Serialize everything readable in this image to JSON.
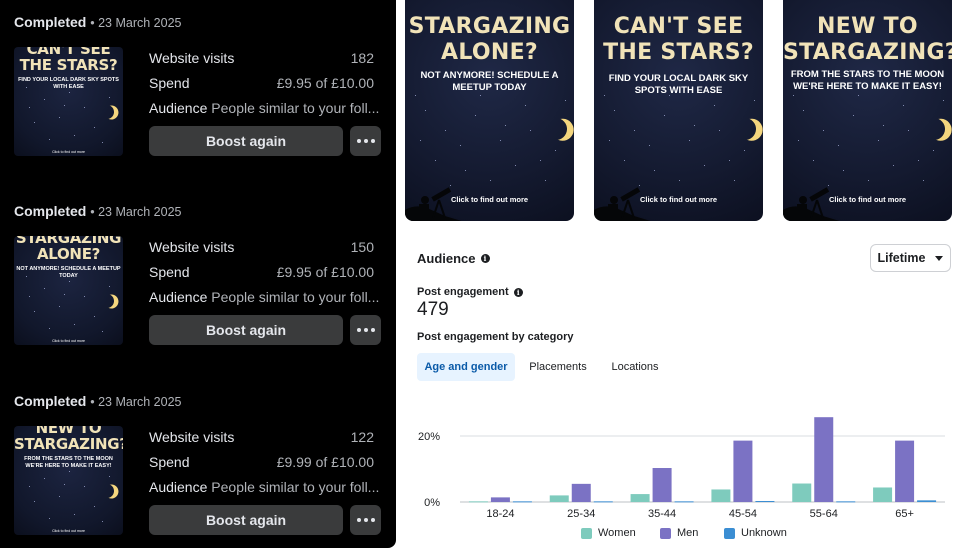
{
  "campaigns": [
    {
      "status": "Completed",
      "date": "• 23 March 2025",
      "thumb_headline": "CAN'T SEE THE STARS?",
      "thumb_subline": "FIND YOUR LOCAL DARK SKY SPOTS WITH EASE",
      "thumb_cta": "Click to find out more",
      "visits_label": "Website visits",
      "visits_value": "182",
      "spend_label": "Spend",
      "spend_value": "£9.95 of £10.00",
      "audience_label": "Audience",
      "audience_value": "People similar to your foll...",
      "boost_label": "Boost again"
    },
    {
      "status": "Completed",
      "date": "• 23 March 2025",
      "thumb_headline": "STARGAZING ALONE?",
      "thumb_subline": "NOT ANYMORE! SCHEDULE A MEETUP TODAY",
      "thumb_cta": "Click to find out more",
      "visits_label": "Website visits",
      "visits_value": "150",
      "spend_label": "Spend",
      "spend_value": "£9.95 of £10.00",
      "audience_label": "Audience",
      "audience_value": "People similar to your foll...",
      "boost_label": "Boost again"
    },
    {
      "status": "Completed",
      "date": "• 23 March 2025",
      "thumb_headline": "NEW TO STARGAZING?",
      "thumb_subline": "FROM THE STARS TO THE MOON WE'RE HERE TO MAKE IT EASY!",
      "thumb_cta": "Click to find out more",
      "visits_label": "Website visits",
      "visits_value": "122",
      "spend_label": "Spend",
      "spend_value": "£9.99 of £10.00",
      "audience_label": "Audience",
      "audience_value": "People similar to your foll...",
      "boost_label": "Boost again"
    }
  ],
  "posters": [
    {
      "headline": "STARGAZING ALONE?",
      "subline": "NOT ANYMORE! SCHEDULE A MEETUP TODAY",
      "cta": "Click to find out more"
    },
    {
      "headline": "CAN'T SEE THE STARS?",
      "subline": "FIND YOUR LOCAL DARK SKY SPOTS WITH EASE",
      "cta": "Click to find out more"
    },
    {
      "headline": "NEW TO STARGAZING?",
      "subline": "FROM THE STARS TO THE MOON WE'RE HERE TO MAKE IT EASY!",
      "cta": "Click to find out more"
    }
  ],
  "audience": {
    "title": "Audience",
    "info_icon": "info-icon",
    "lifetime_label": "Lifetime",
    "post_engagement_label": "Post engagement",
    "post_engagement_value": "479",
    "by_category_label": "Post engagement by category",
    "tabs": [
      "Age and gender",
      "Placements",
      "Locations"
    ],
    "active_tab": "Age and gender"
  },
  "colors": {
    "women": "#7ecbbd",
    "men": "#7b72c4",
    "unknown": "#3b8ed3",
    "headline": "#f1e3b8",
    "moon": "#f4d67e"
  },
  "chart_data": {
    "type": "bar",
    "categories": [
      "18-24",
      "25-34",
      "35-44",
      "45-54",
      "55-64",
      "65+"
    ],
    "series": [
      {
        "name": "Women",
        "values": [
          0.2,
          2.0,
          2.4,
          3.8,
          5.6,
          4.4
        ]
      },
      {
        "name": "Men",
        "values": [
          1.4,
          5.5,
          10.3,
          18.6,
          25.7,
          18.6
        ]
      },
      {
        "name": "Unknown",
        "values": [
          0.2,
          0.2,
          0.2,
          0.3,
          0.2,
          0.5
        ]
      }
    ],
    "yticks": [
      "0%",
      "20%"
    ],
    "ylim": [
      0,
      28
    ],
    "grid": true,
    "legend": "bottom"
  }
}
